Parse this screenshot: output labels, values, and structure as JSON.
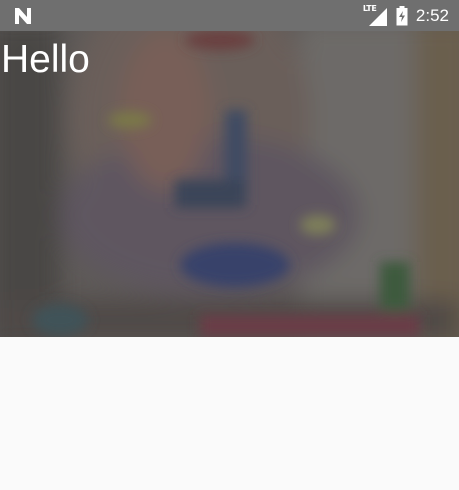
{
  "status_bar": {
    "notification_icon": "n-icon",
    "network_type": "LTE",
    "signal_icon": "signal-icon",
    "battery_icon": "battery-icon",
    "time": "2:52"
  },
  "hero": {
    "title": "Hello",
    "image": "blurred-photo"
  }
}
